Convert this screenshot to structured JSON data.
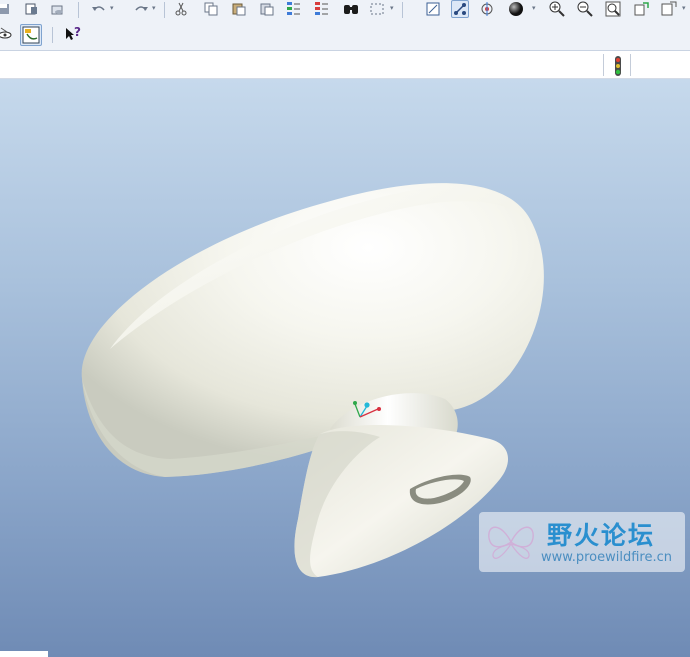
{
  "toolbar_row1": {
    "icons": [
      "save-icon",
      "print-icon",
      "email-icon",
      "undo-icon",
      "redo-icon",
      "cut-icon",
      "copy-icon",
      "paste-icon",
      "paste-special-icon",
      "regenerate-icon",
      "regenerate-manager-icon",
      "find-icon",
      "selection-box-icon",
      "repaint-icon",
      "orient-mode-icon",
      "spin-center-icon",
      "display-style-icon",
      "zoom-in-icon",
      "zoom-out-icon",
      "refit-icon",
      "reorient-icon",
      "saved-views-icon"
    ]
  },
  "toolbar_row2": {
    "icons": [
      "layer-visibility-icon",
      "model-tree-toggle-icon",
      "context-help-icon"
    ],
    "help_label": "?"
  },
  "status": {
    "indicator": "traffic-light-icon"
  },
  "watermark": {
    "title": "野火论坛",
    "url": "www.proewildfire.cn"
  },
  "colors": {
    "viewport_top": "#c6d9ec",
    "viewport_bottom": "#6f8bb5",
    "model": "#f3f2ea",
    "watermark_text": "#2a8fcf"
  }
}
